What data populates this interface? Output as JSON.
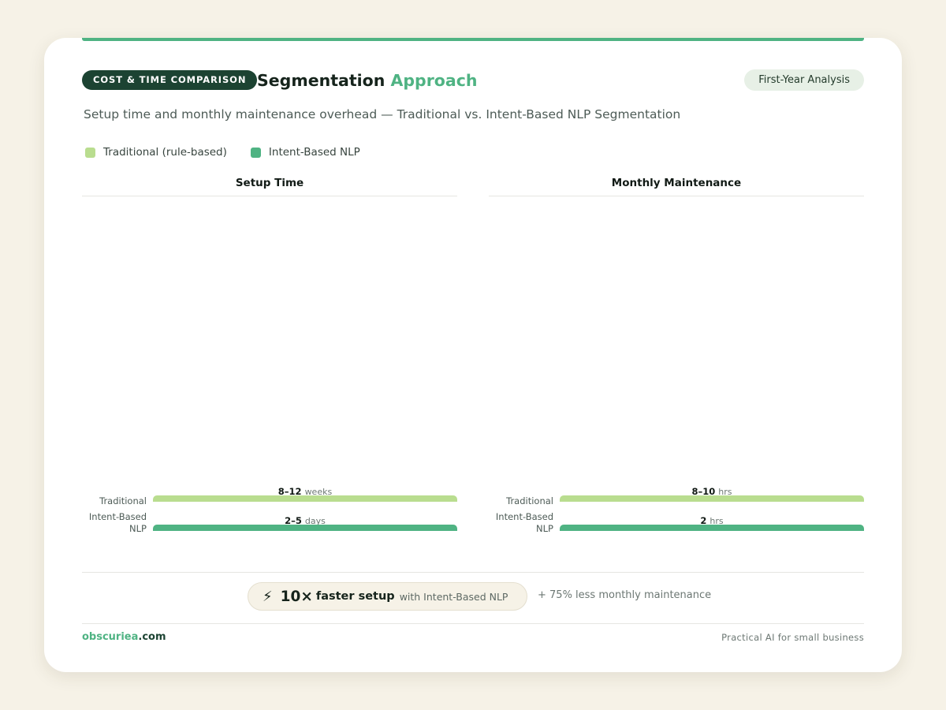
{
  "header": {
    "badge": "COST & TIME COMPARISON",
    "title_main": "Segmentation",
    "title_accent": "Approach",
    "pill": "First-Year Analysis"
  },
  "subtitle": "Setup time and monthly maintenance overhead — Traditional vs. Intent-Based NLP Segmentation",
  "colors": {
    "traditional": "#b9dd8f",
    "intent_based": "#4fb383",
    "brand_dark": "#1c4332",
    "accent": "#4fb383"
  },
  "chart_data": [
    {
      "type": "bar",
      "orientation": "horizontal",
      "title": "Setup Time",
      "categories": [
        "Traditional",
        "Intent-Based NLP"
      ],
      "series": [
        {
          "name": "Traditional (rule-based)",
          "value_label": "8–12",
          "unit": "weeks",
          "low": 8,
          "high": 12
        },
        {
          "name": "Intent-Based NLP",
          "value_label": "2–5",
          "unit": "days",
          "low": 2,
          "high": 5
        }
      ],
      "legend": "top-left",
      "grid": false
    },
    {
      "type": "bar",
      "orientation": "horizontal",
      "title": "Monthly Maintenance",
      "categories": [
        "Traditional",
        "Intent-Based NLP"
      ],
      "series": [
        {
          "name": "Traditional (rule-based)",
          "value_label": "8–10",
          "unit": "hrs",
          "low": 8,
          "high": 10
        },
        {
          "name": "Intent-Based NLP",
          "value_label": "2",
          "unit": "hrs",
          "low": 2,
          "high": 2
        }
      ],
      "legend": "top-left",
      "grid": false
    }
  ],
  "callout": {
    "icon": "lightning-bolt-icon",
    "glyph": "⚡",
    "multiplier": "10×",
    "headline": "faster setup",
    "detail": "with Intent-Based NLP",
    "note": "+ 75% less monthly maintenance"
  },
  "footer": {
    "brand_a": "obscuriea",
    "brand_b": ".com",
    "tagline": "Practical AI for small business"
  }
}
